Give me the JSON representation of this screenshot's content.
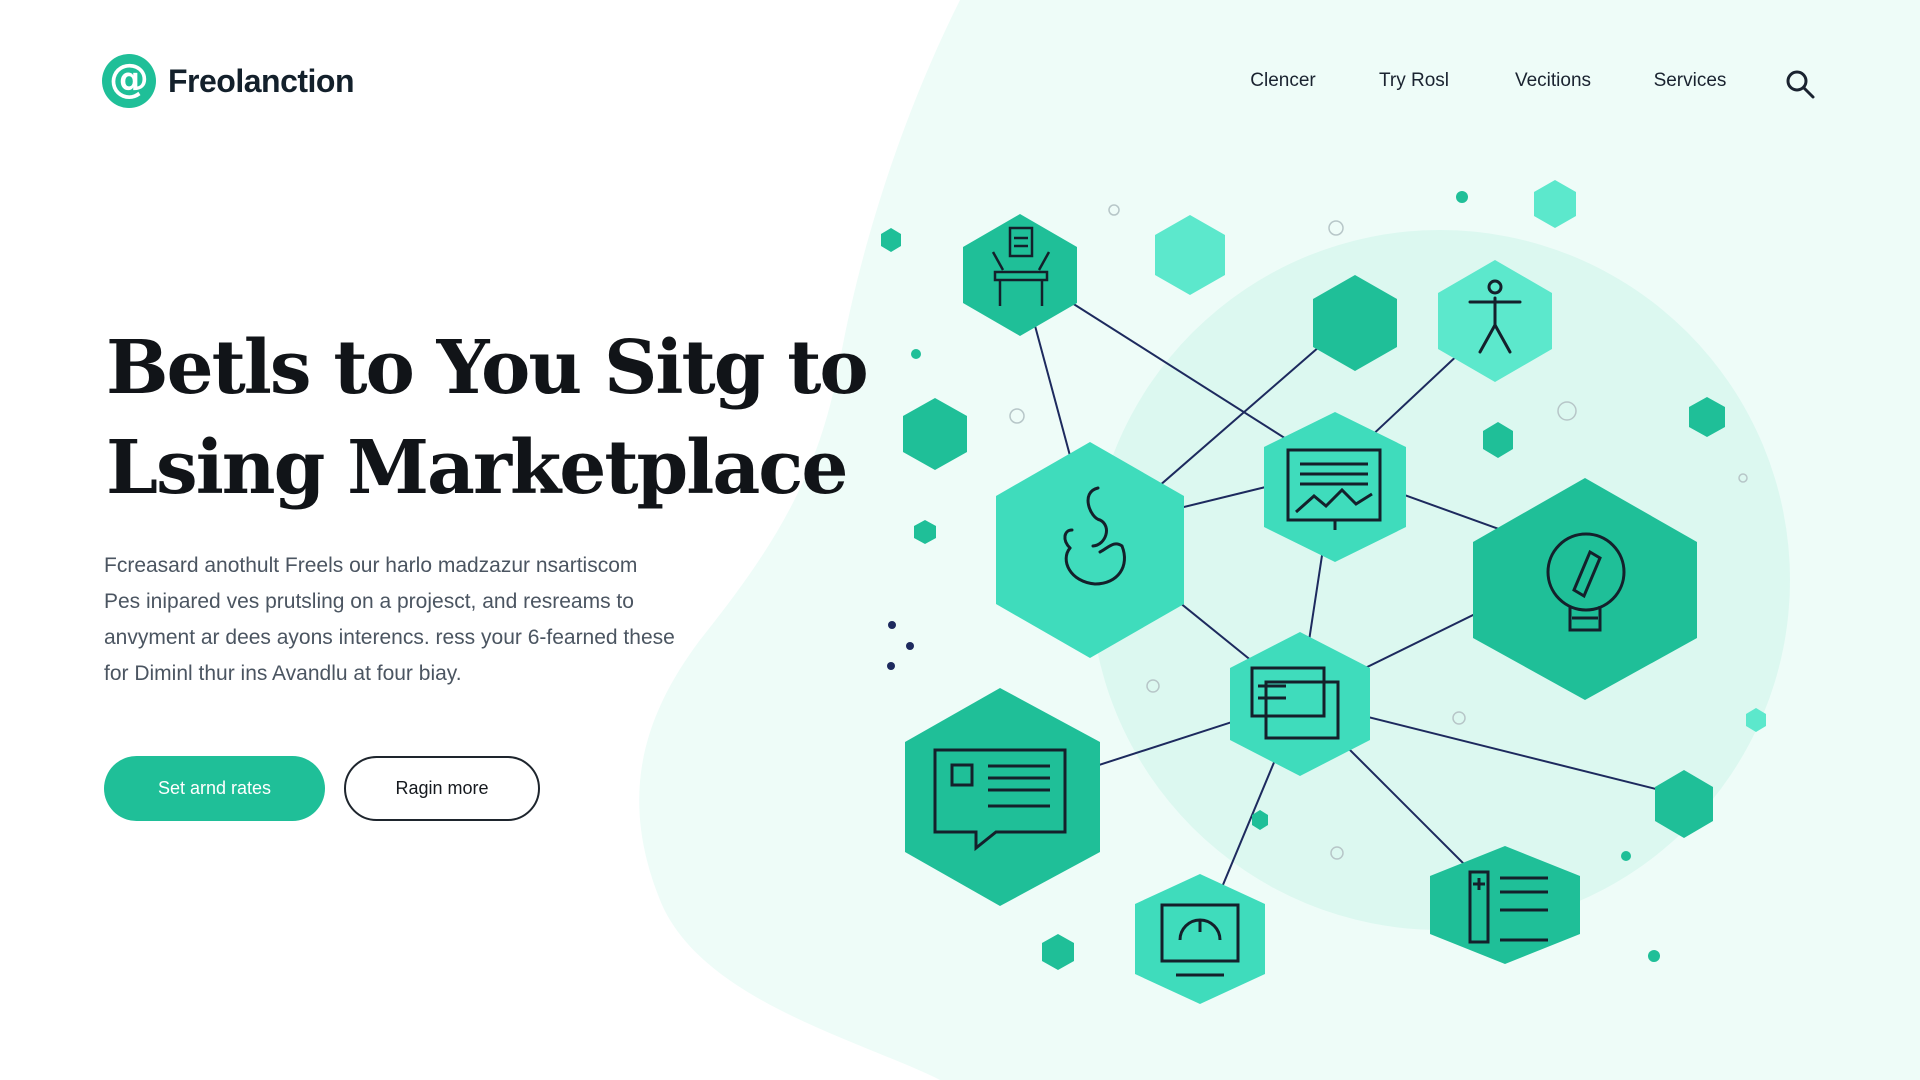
{
  "brand": {
    "name": "Freolanction",
    "logo_glyph": "@",
    "accent_color": "#1fbf98",
    "accent_dark": "#13a886",
    "light_accent": "#5ce8cc",
    "blob_color": "#eefcf8",
    "line_color": "#1d2a5e"
  },
  "nav": {
    "items": [
      {
        "label": "Clencer"
      },
      {
        "label": "Try Rosl"
      },
      {
        "label": "Vecitions"
      },
      {
        "label": "Services"
      }
    ],
    "search_icon": "search-icon"
  },
  "hero": {
    "title_lines": [
      "Betls to You Sitg to",
      "Lsing Marketplace"
    ],
    "description_lines": [
      "Fcreasard anothult Freels our harlo madzazur nsartiscom",
      "Pes inipared ves prutsling on a projesct, and resreams to",
      "anvyment ar dees ayons interencs. ress your 6-fearned these",
      "for Diminl thur ins Avandlu at four biay."
    ],
    "primary_button": "Set arnd rates",
    "secondary_button": "Ragin more"
  },
  "illustration": {
    "nodes": [
      {
        "name": "desk-icon"
      },
      {
        "name": "person-icon"
      },
      {
        "name": "swan-icon"
      },
      {
        "name": "landscape-monitor-icon"
      },
      {
        "name": "lightbulb-icon"
      },
      {
        "name": "windows-icon"
      },
      {
        "name": "chat-document-icon"
      },
      {
        "name": "gauge-monitor-icon"
      },
      {
        "name": "checklist-icon"
      }
    ]
  }
}
